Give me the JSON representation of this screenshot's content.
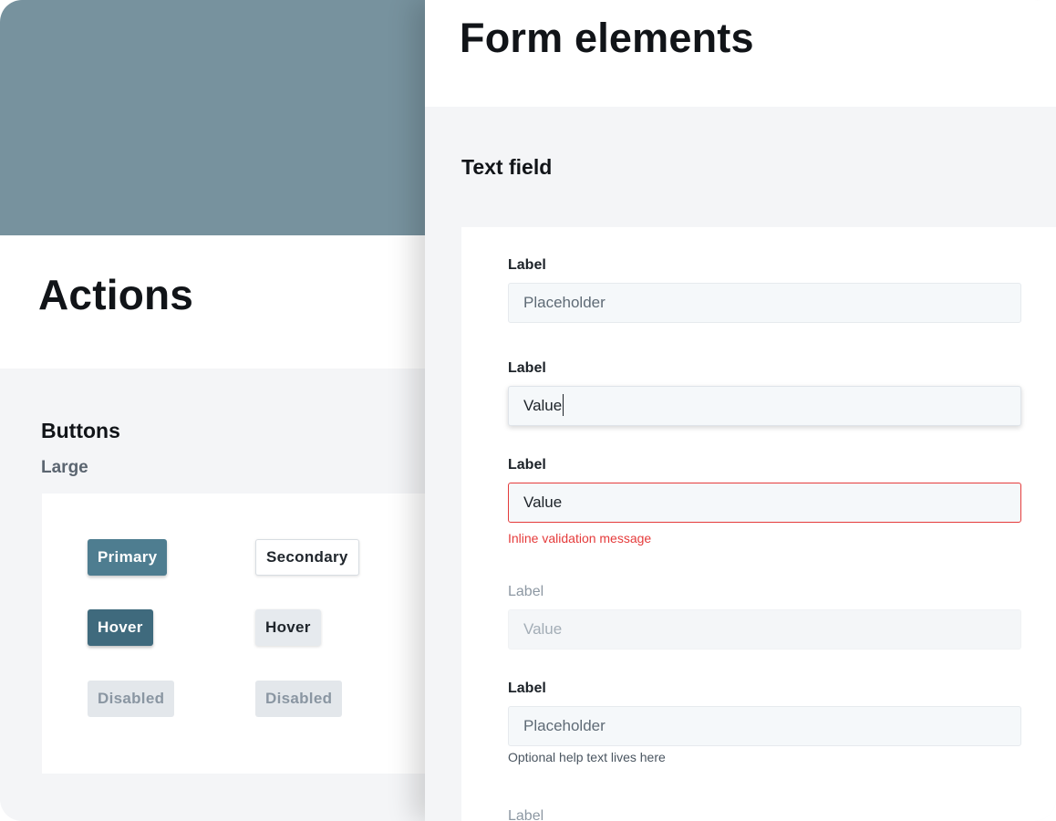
{
  "actions": {
    "title": "Actions",
    "section_title": "Buttons",
    "size_label": "Large",
    "buttons": {
      "primary": "Primary",
      "secondary": "Secondary",
      "primary_hover": "Hover",
      "secondary_hover": "Hover",
      "primary_disabled": "Disabled",
      "secondary_disabled": "Disabled"
    }
  },
  "form": {
    "title": "Form elements",
    "section_title": "Text field",
    "fields": [
      {
        "label": "Label",
        "state": "placeholder",
        "text": "Placeholder"
      },
      {
        "label": "Label",
        "state": "focused",
        "text": "Value"
      },
      {
        "label": "Label",
        "state": "error",
        "text": "Value",
        "message": "Inline validation message"
      },
      {
        "label": "Label",
        "state": "disabled",
        "text": "Value"
      },
      {
        "label": "Label",
        "state": "help",
        "text": "Placeholder",
        "help": "Optional help text lives here"
      },
      {
        "label": "Label"
      }
    ]
  },
  "colors": {
    "hero": "#77929e",
    "primary": "#4e7d90",
    "primary_hover": "#3f6a7d",
    "error": "#e53b3b",
    "panel_bg": "#f4f5f7"
  }
}
